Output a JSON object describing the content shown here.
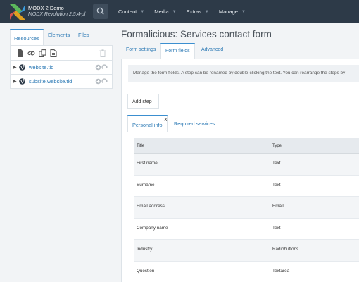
{
  "header": {
    "app_name": "MODX 2 Demo",
    "version": "MODX Revolution 2.5.4-pl",
    "nav": [
      {
        "label": "Content"
      },
      {
        "label": "Media"
      },
      {
        "label": "Extras"
      },
      {
        "label": "Manage"
      }
    ]
  },
  "sidebar": {
    "tabs": [
      {
        "label": "Resources"
      },
      {
        "label": "Elements"
      },
      {
        "label": "Files"
      }
    ],
    "tree": [
      {
        "label": "website.tld"
      },
      {
        "label": "subsite.website.tld"
      }
    ]
  },
  "main": {
    "title": "Formalicious: Services contact form",
    "tabs": [
      {
        "label": "Form settings"
      },
      {
        "label": "Form fields"
      },
      {
        "label": "Advanced"
      }
    ],
    "description": "Manage the form fields. A step can be renamed by double-clicking the text. You can rearrange the steps by",
    "add_step_label": "Add step",
    "step_tabs": [
      {
        "label": "Personal info"
      },
      {
        "label": "Required services"
      }
    ],
    "table": {
      "headers": [
        "Title",
        "Type"
      ],
      "rows": [
        [
          "First name",
          "Text"
        ],
        [
          "Surname",
          "Text"
        ],
        [
          "Email address",
          "Email"
        ],
        [
          "Company name",
          "Text"
        ],
        [
          "Industry",
          "Radiobuttons"
        ],
        [
          "Question",
          "Textarea"
        ]
      ]
    }
  },
  "colors": {
    "topbar": "#2d3a48",
    "accent": "#3b8fd0",
    "link": "#2a78b4",
    "background": "#f2f4f6"
  },
  "icons": {
    "logo": "modx-logo",
    "search": "search-icon",
    "tree_item": "globe-icon",
    "toolbar": [
      "document-icon",
      "link-icon",
      "copy-icon",
      "file-icon",
      "trash-icon"
    ]
  }
}
